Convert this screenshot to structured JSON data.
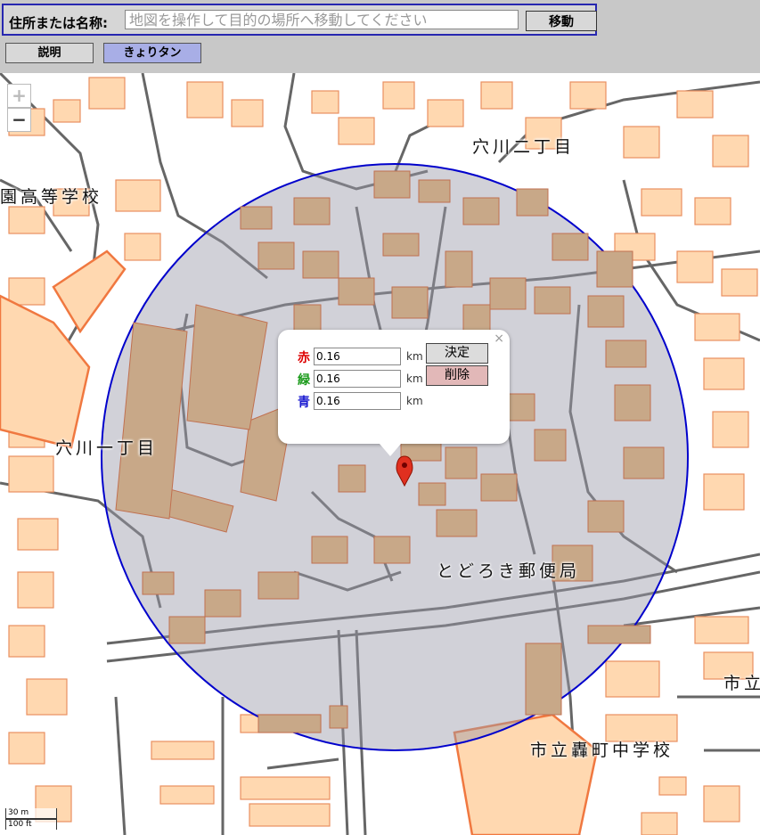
{
  "search": {
    "label": "住所または名称:",
    "placeholder": "地図を操作して目的の場所へ移動してください",
    "value": "",
    "button": "移動"
  },
  "toolbar": {
    "help": "説明",
    "kyori": "きょりタン"
  },
  "zoom": {
    "in": "+",
    "out": "−"
  },
  "labels": {
    "anagawa2": "穴川二丁目",
    "school_left": "園高等学校",
    "anagawa1": "穴川一丁目",
    "post_office": "とどろき郵便局",
    "shiritsu": "市立",
    "jhs": "市立轟町中学校"
  },
  "popup": {
    "close": "×",
    "rows": [
      {
        "label": "赤",
        "color": "#dd0000",
        "value": "0.16",
        "unit": "km"
      },
      {
        "label": "緑",
        "color": "#1a9a1a",
        "value": "0.16",
        "unit": "km"
      },
      {
        "label": "青",
        "color": "#1a1ad0",
        "value": "0.16",
        "unit": "km"
      }
    ],
    "ok": "決定",
    "delete": "削除"
  },
  "scale": {
    "metric": "30 m",
    "imperial": "100 ft"
  },
  "colors": {
    "circle_stroke": "#0000cc",
    "circle_fill": "#9a9aa8",
    "building_fill": "#ffd8b0",
    "building_stroke": "#e89060",
    "road": "#666666"
  }
}
